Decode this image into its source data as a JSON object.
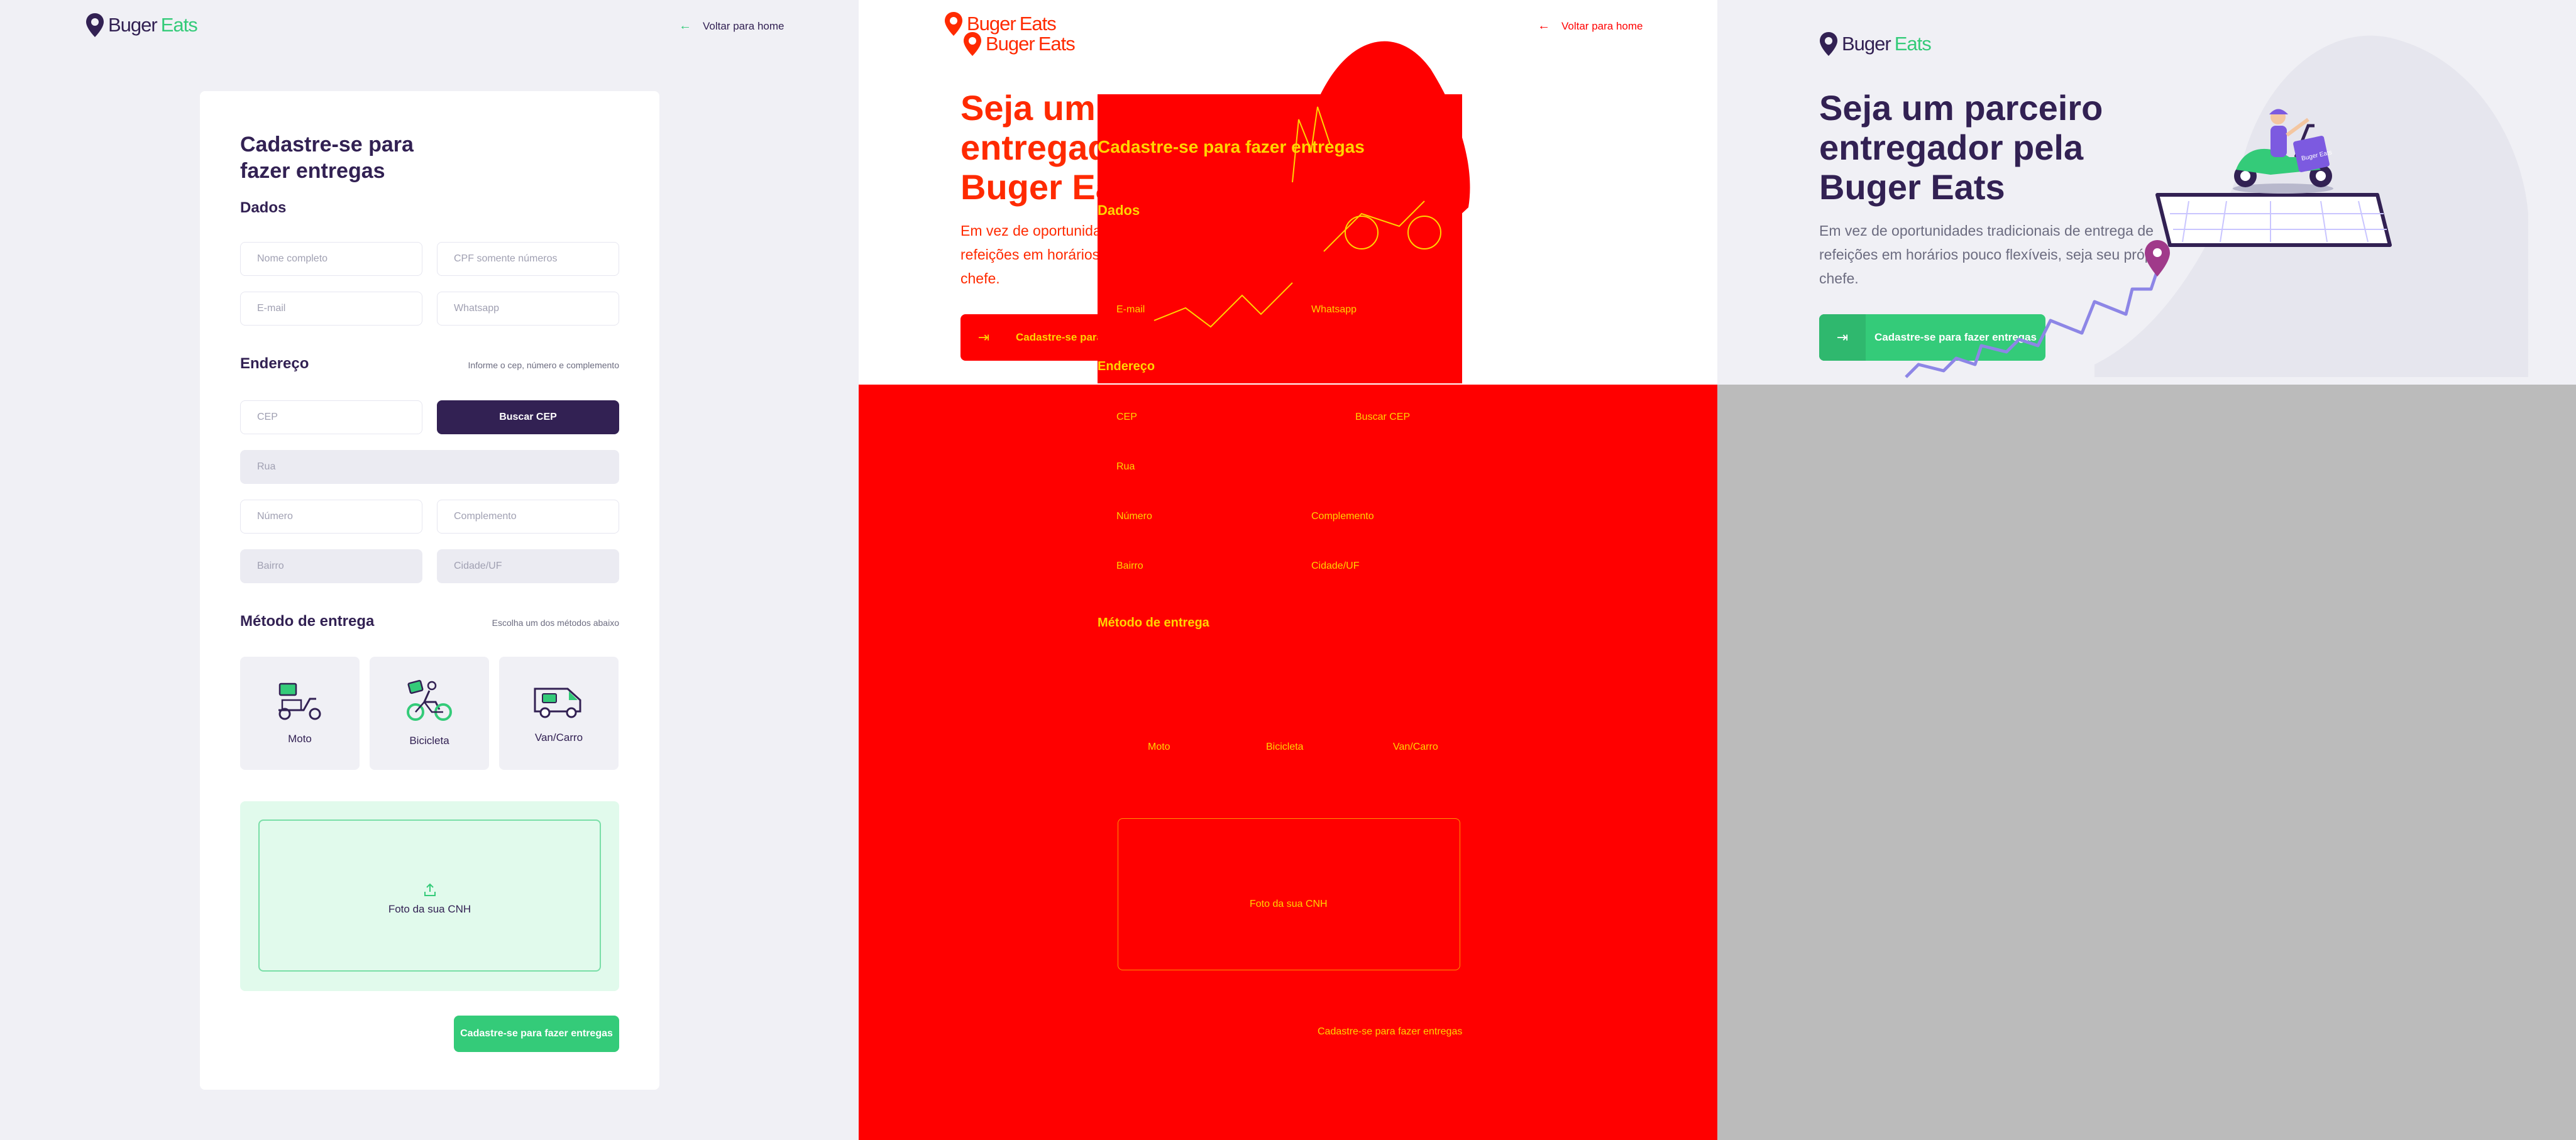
{
  "brand": {
    "name_part1": "Buger",
    "name_part2": "Eats",
    "color_dark": "#322153",
    "color_green": "#34cb79"
  },
  "back_link": {
    "label": "Voltar para home"
  },
  "form": {
    "title": "Cadastre-se para fazer entregas",
    "dados_title": "Dados",
    "fields": {
      "name": "Nome completo",
      "cpf": "CPF somente números",
      "email": "E-mail",
      "whatsapp": "Whatsapp",
      "cep": "CEP",
      "street": "Rua",
      "number": "Número",
      "complement": "Complemento",
      "district": "Bairro",
      "city_uf": "Cidade/UF"
    },
    "address_title": "Endereço",
    "address_hint": "Informe o cep, número e complemento",
    "search_cep_button": "Buscar CEP",
    "method_title": "Método de entrega",
    "method_hint": "Escolha um dos métodos abaixo",
    "methods": [
      "Moto",
      "Bicicleta",
      "Van/Carro"
    ],
    "upload_label": "Foto da sua CNH",
    "submit_button": "Cadastre-se para fazer entregas"
  },
  "home": {
    "hero_title": "Seja um parceiro entregador pela Buger Eats",
    "hero_text": "Em vez de oportunidades tradicionais de entrega de refeições em horários pouco flexíveis, seja seu próprio chefe.",
    "cta_button": "Cadastre-se para fazer entregas",
    "bag_text": "Buger Eats"
  },
  "overlay": {
    "form_title": "Cadastre-se para fazer entregas",
    "labels": [
      "Dados",
      "E-mail",
      "Whatsapp",
      "Endereço",
      "CEP",
      "Buscar CEP",
      "Rua",
      "Número",
      "Complemento",
      "Bairro",
      "Cidade/UF",
      "Método de entrega",
      "Moto",
      "Bicicleta",
      "Van/Carro",
      "Foto da sua CNH",
      "Cadastre-se para fazer entregas"
    ]
  },
  "colors": {
    "diff_red": "#ff0000",
    "diff_yellow": "#ffd400",
    "diff_gray": "#bbbbbb",
    "bg": "#f0f0f5"
  }
}
